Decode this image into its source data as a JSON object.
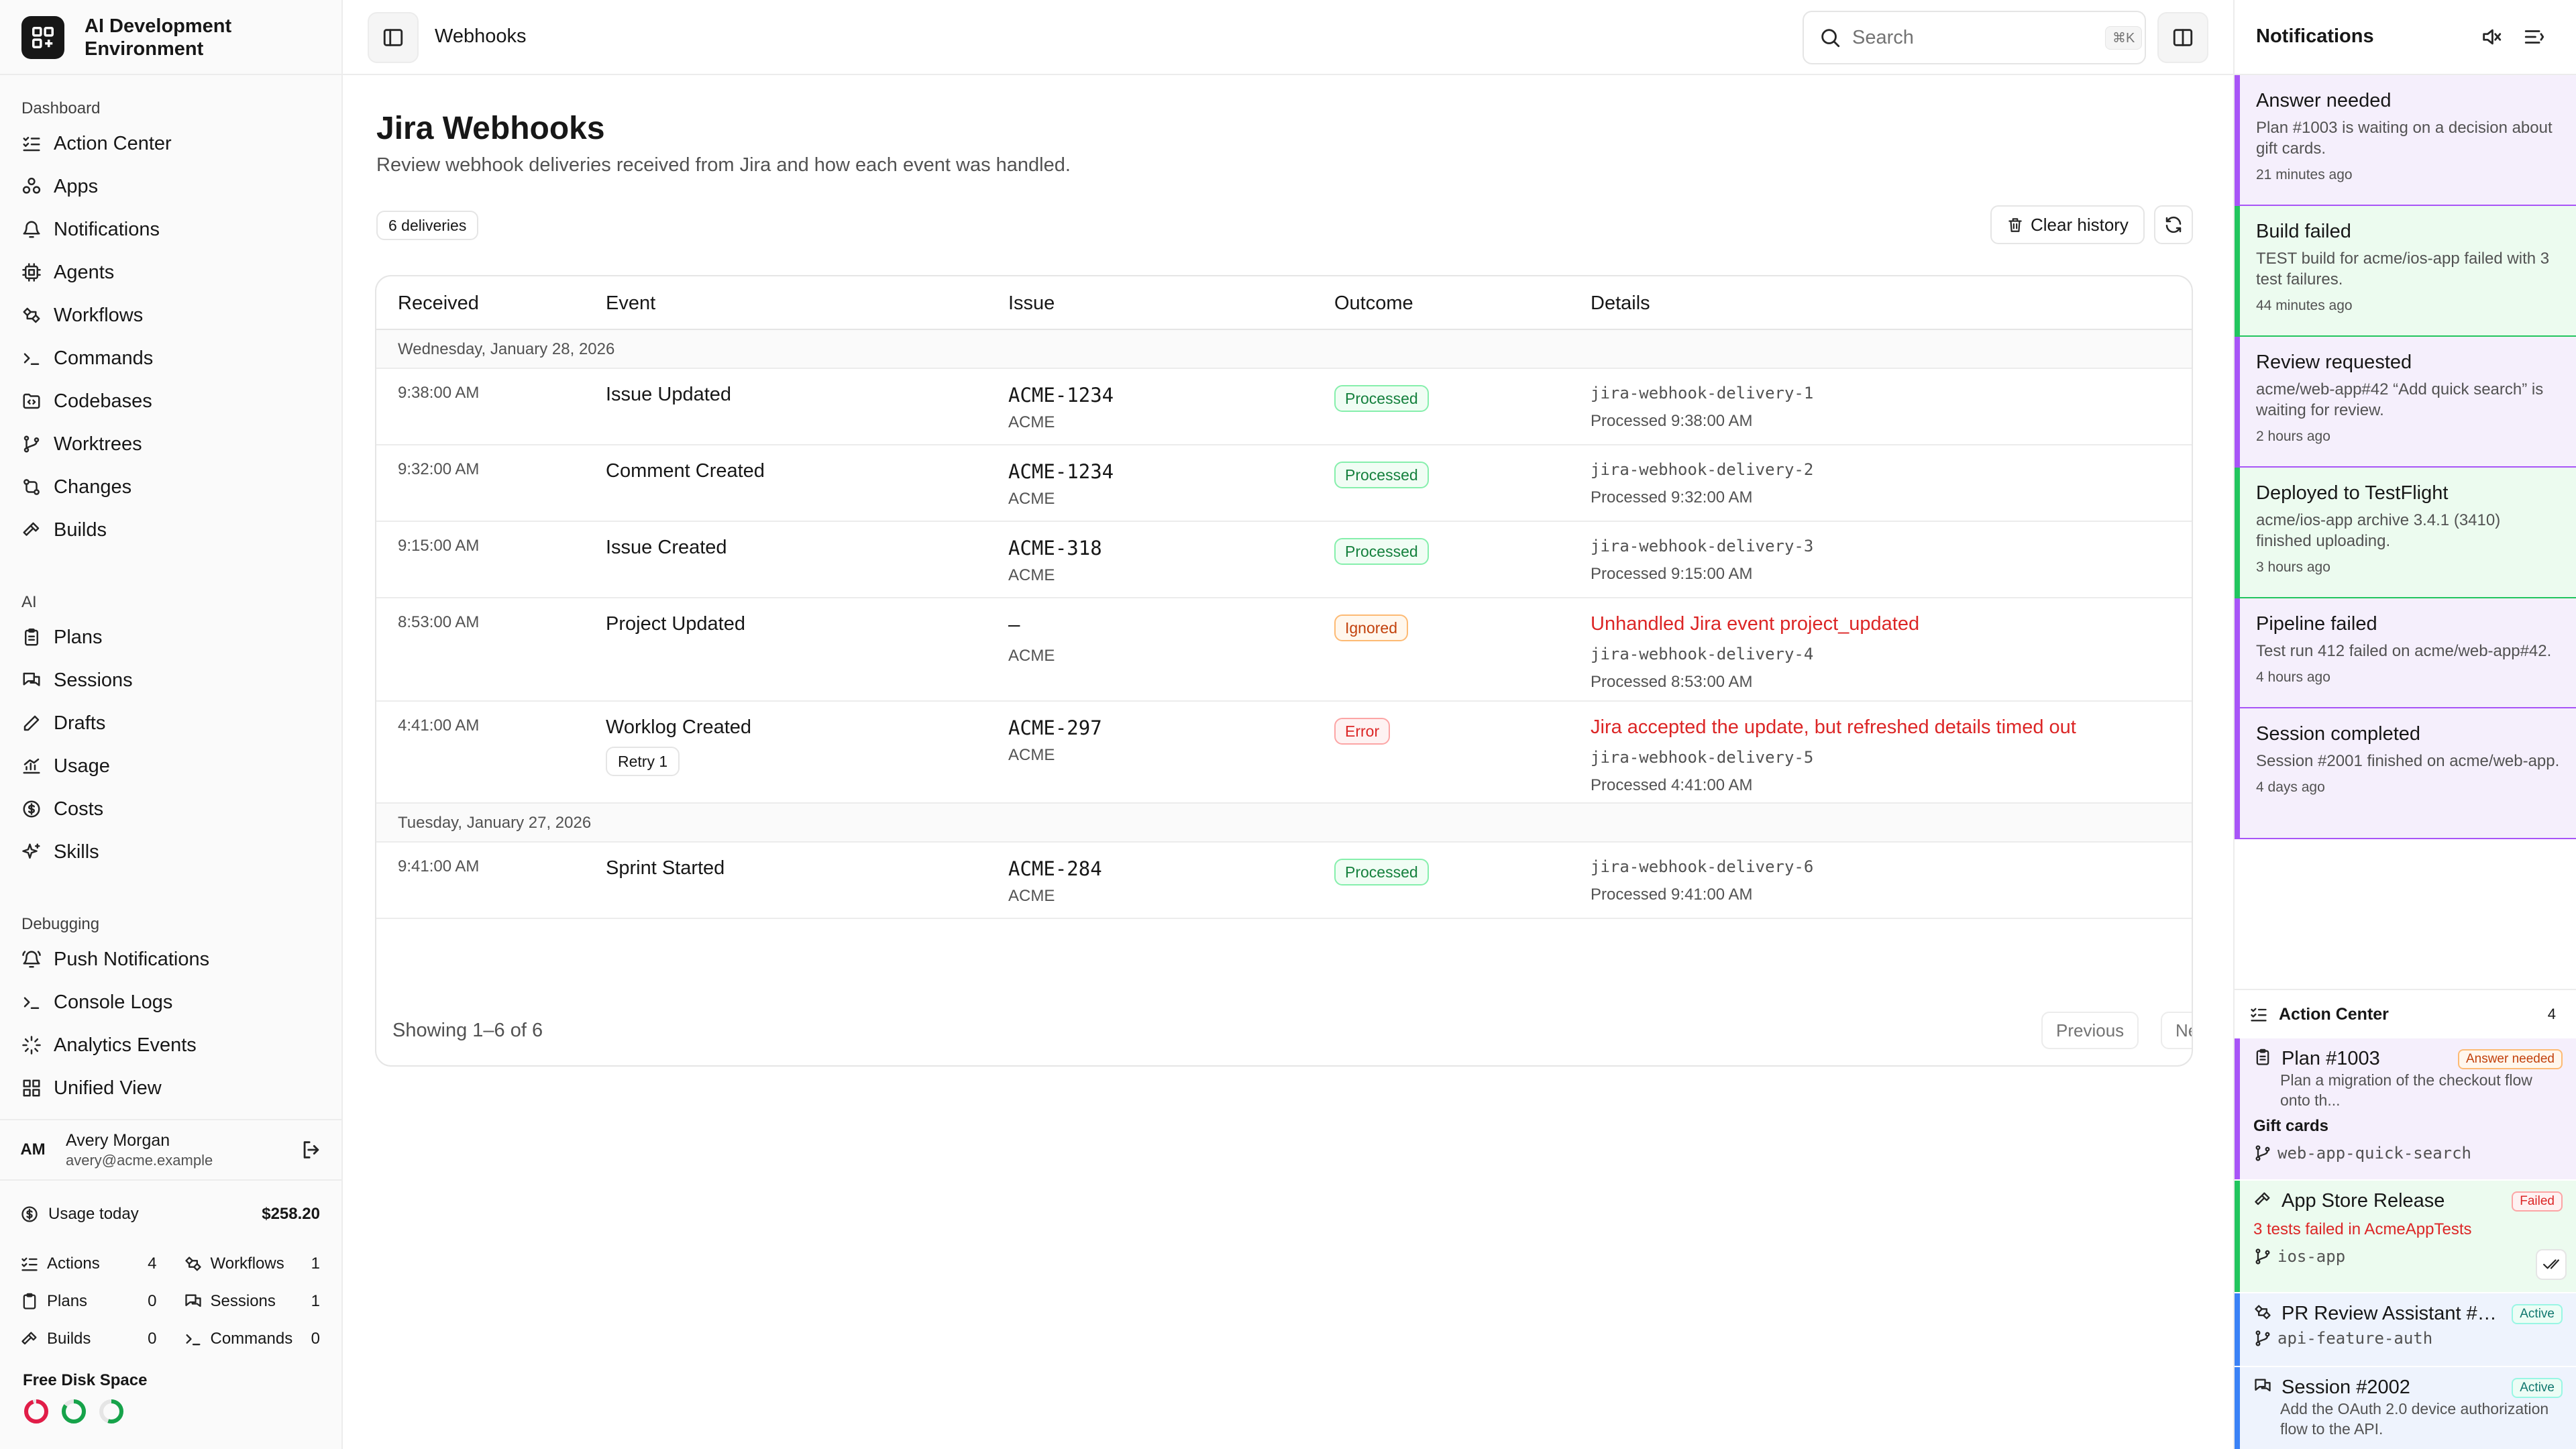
{
  "app": {
    "title": "AI Development Environment"
  },
  "sidebar": {
    "sections": [
      {
        "heading": "Dashboard",
        "items": [
          {
            "label": "Action Center",
            "icon": "list-checks-icon"
          },
          {
            "label": "Apps",
            "icon": "apps-icon"
          },
          {
            "label": "Notifications",
            "icon": "bell-icon"
          },
          {
            "label": "Agents",
            "icon": "cpu-icon"
          },
          {
            "label": "Workflows",
            "icon": "workflow-icon"
          },
          {
            "label": "Commands",
            "icon": "terminal-icon"
          },
          {
            "label": "Codebases",
            "icon": "folder-code-icon"
          },
          {
            "label": "Worktrees",
            "icon": "git-branch-icon"
          },
          {
            "label": "Changes",
            "icon": "git-compare-icon"
          },
          {
            "label": "Builds",
            "icon": "hammer-icon"
          }
        ]
      },
      {
        "heading": "AI",
        "items": [
          {
            "label": "Plans",
            "icon": "clipboard-icon"
          },
          {
            "label": "Sessions",
            "icon": "messages-icon"
          },
          {
            "label": "Drafts",
            "icon": "edit-icon"
          },
          {
            "label": "Usage",
            "icon": "chart-icon"
          },
          {
            "label": "Costs",
            "icon": "dollar-icon"
          },
          {
            "label": "Skills",
            "icon": "sparkles-icon"
          }
        ]
      },
      {
        "heading": "Debugging",
        "items": [
          {
            "label": "Push Notifications",
            "icon": "bell-ring-icon"
          },
          {
            "label": "Console Logs",
            "icon": "terminal-icon"
          },
          {
            "label": "Analytics Events",
            "icon": "activity-icon"
          },
          {
            "label": "Unified View",
            "icon": "layout-icon"
          }
        ]
      }
    ],
    "user": {
      "initials": "AM",
      "name": "Avery Morgan",
      "email": "avery@acme.example"
    },
    "usage": {
      "label": "Usage today",
      "amount": "$258.20",
      "stats": [
        {
          "label": "Actions",
          "value": "4"
        },
        {
          "label": "Workflows",
          "value": "1"
        },
        {
          "label": "Plans",
          "value": "0"
        },
        {
          "label": "Sessions",
          "value": "1"
        },
        {
          "label": "Builds",
          "value": "0"
        },
        {
          "label": "Commands",
          "value": "0"
        }
      ]
    },
    "disk": {
      "label": "Free Disk Space",
      "rings": [
        {
          "color": "#e11d48",
          "fraction": 0.95
        },
        {
          "color": "#16a34a",
          "fraction": 0.85
        },
        {
          "color": "#16a34a",
          "fraction": 0.55
        }
      ]
    }
  },
  "topbar": {
    "breadcrumb": "Webhooks",
    "search_placeholder": "Search",
    "search_shortcut": "⌘K"
  },
  "page": {
    "title": "Jira Webhooks",
    "subtitle": "Review webhook deliveries received from Jira and how each event was handled.",
    "count": "6 deliveries",
    "clear_label": "Clear history",
    "columns": [
      "Received",
      "Event",
      "Issue",
      "Outcome",
      "Details"
    ],
    "groups": [
      {
        "date": "Wednesday, January 28, 2026",
        "rows": [
          {
            "received": "9:38:00 AM",
            "event": "Issue Updated",
            "issue": "ACME-1234",
            "project": "ACME",
            "outcome": "Processed",
            "error": "",
            "delivery": "jira-webhook-delivery-1",
            "processed": "Processed 9:38:00 AM",
            "retry": ""
          },
          {
            "received": "9:32:00 AM",
            "event": "Comment Created",
            "issue": "ACME-1234",
            "project": "ACME",
            "outcome": "Processed",
            "error": "",
            "delivery": "jira-webhook-delivery-2",
            "processed": "Processed 9:32:00 AM",
            "retry": ""
          },
          {
            "received": "9:15:00 AM",
            "event": "Issue Created",
            "issue": "ACME-318",
            "project": "ACME",
            "outcome": "Processed",
            "error": "",
            "delivery": "jira-webhook-delivery-3",
            "processed": "Processed 9:15:00 AM",
            "retry": ""
          },
          {
            "received": "8:53:00 AM",
            "event": "Project Updated",
            "issue": "–",
            "project": "ACME",
            "outcome": "Ignored",
            "error": "Unhandled Jira event project_updated",
            "delivery": "jira-webhook-delivery-4",
            "processed": "Processed 8:53:00 AM",
            "retry": ""
          },
          {
            "received": "4:41:00 AM",
            "event": "Worklog Created",
            "issue": "ACME-297",
            "project": "ACME",
            "outcome": "Error",
            "error": "Jira accepted the update, but refreshed details timed out",
            "delivery": "jira-webhook-delivery-5",
            "processed": "Processed 4:41:00 AM",
            "retry": "Retry 1"
          }
        ]
      },
      {
        "date": "Tuesday, January 27, 2026",
        "rows": [
          {
            "received": "9:41:00 AM",
            "event": "Sprint Started",
            "issue": "ACME-284",
            "project": "ACME",
            "outcome": "Processed",
            "error": "",
            "delivery": "jira-webhook-delivery-6",
            "processed": "Processed 9:41:00 AM",
            "retry": ""
          }
        ]
      }
    ],
    "footer": {
      "showing": "Showing 1–6 of 6",
      "previous": "Previous",
      "next": "Next"
    }
  },
  "notifications": {
    "title": "Notifications",
    "items": [
      {
        "title": "Answer needed",
        "body": "Plan #1003 is waiting on a decision about gift cards.",
        "time": "21 minutes ago",
        "color": "purple"
      },
      {
        "title": "Build failed",
        "body": "TEST build for acme/ios-app failed with 3 test failures.",
        "time": "44 minutes ago",
        "color": "green"
      },
      {
        "title": "Review requested",
        "body": "acme/web-app#42 “Add quick search” is waiting for review.",
        "time": "2 hours ago",
        "color": "purple"
      },
      {
        "title": "Deployed to TestFlight",
        "body": "acme/ios-app archive 3.4.1 (3410) finished uploading.",
        "time": "3 hours ago",
        "color": "green"
      },
      {
        "title": "Pipeline failed",
        "body": "Test run 412 failed on acme/web-app#42.",
        "time": "4 hours ago",
        "color": "purple"
      },
      {
        "title": "Session completed",
        "body": "Session #2001 finished on acme/web-app.",
        "time": "4 days ago",
        "color": "purple"
      }
    ]
  },
  "action_center": {
    "title": "Action Center",
    "count": "4",
    "items": [
      {
        "name": "Plan #1003",
        "badge": "Answer needed",
        "desc": "Plan a migration of the checkout flow onto th...",
        "sub": "Gift cards",
        "branch": "web-app-quick-search",
        "failure": ""
      },
      {
        "name": "App Store Release",
        "badge": "Failed",
        "desc": "",
        "sub": "",
        "branch": "ios-app",
        "failure": "3 tests failed in AcmeAppTests"
      },
      {
        "name": "PR Review Assistant #4...",
        "badge": "Active",
        "desc": "",
        "sub": "",
        "branch": "api-feature-auth",
        "failure": ""
      },
      {
        "name": "Session #2002",
        "badge": "Active",
        "desc": "Add the OAuth 2.0 device authorization flow to the API.",
        "sub": "",
        "branch": "",
        "failure": ""
      }
    ]
  }
}
